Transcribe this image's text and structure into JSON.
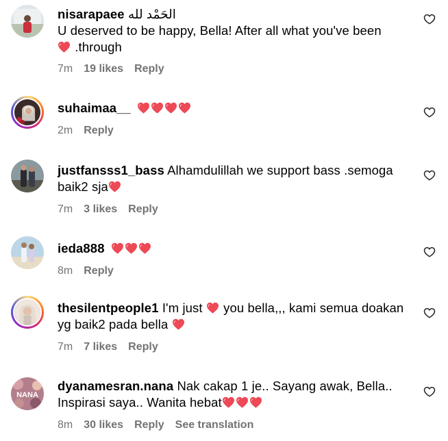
{
  "colors": {
    "heart": "#ed4956",
    "meta": "#737373",
    "ring": "#d62976"
  },
  "comments": [
    {
      "username": "nisarapaee",
      "text_a": " الحَمْد لله",
      "text_b": "U deserved to be happy, Bella! After all what you've been",
      "text_c": " .through",
      "time": "7m",
      "likes": "19 likes",
      "reply": "Reply"
    },
    {
      "username": "suhaimaa__",
      "time": "2m",
      "reply": "Reply"
    },
    {
      "username": "justfansss1_bass",
      "text_a": " Alhamdulillah we support bass .semoga",
      "text_b": "baik2 sja",
      "time": "7m",
      "likes": "3 likes",
      "reply": "Reply"
    },
    {
      "username": "ieda888",
      "time": "8m",
      "reply": "Reply"
    },
    {
      "username": "thesilentpeople1",
      "text_a": " I'm just ",
      "text_b": " you bella,,, kami semua doakan",
      "text_c": "yg baik2 pada bella ",
      "time": "7m",
      "likes": "7 likes",
      "reply": "Reply"
    },
    {
      "username": "dyanamesran.nana",
      "text_a": " Nak cakap 1 je.. Sayang awak, Bella..",
      "text_b": "Inspirasi saya.. Wanita hebat",
      "avatar_text": "NANA",
      "time": "8m",
      "likes": "30 likes",
      "reply": "Reply",
      "translation": "See translation"
    }
  ]
}
